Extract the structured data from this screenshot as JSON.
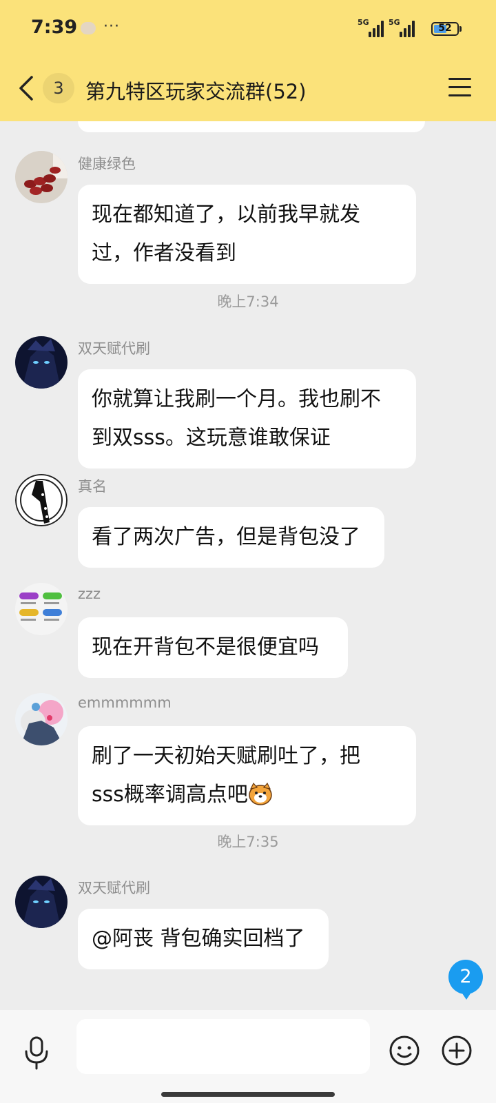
{
  "status_bar": {
    "time": "7:39",
    "dots": "···",
    "signal_1_label": "5G",
    "signal_2_label": "5G",
    "battery": "52"
  },
  "header": {
    "unread_count": "3",
    "title": "第九特区玩家交流群(52)",
    "back_icon": "chevron-left-icon",
    "menu_icon": "hamburger-menu-icon"
  },
  "messages": [
    {
      "sender": "健康绿色",
      "lines": [
        "现在都知道了，以前我早就发",
        "过，作者没看到"
      ]
    },
    {
      "timestamp": "晚上7:34"
    },
    {
      "sender": "双天赋代刷",
      "lines": [
        "你就算让我刷一个月。我也刷不",
        "到双sss。这玩意谁敢保证"
      ]
    },
    {
      "sender": "真名",
      "lines": [
        "看了两次广告，但是背包没了"
      ]
    },
    {
      "sender": "zzz",
      "lines": [
        "现在开背包不是很便宜吗"
      ]
    },
    {
      "sender": "emmmmmm",
      "lines": [
        "刷了一天初始天赋刷吐了，把",
        "sss概率调高点吧"
      ]
    },
    {
      "timestamp": "晚上7:35"
    },
    {
      "sender": "双天赋代刷",
      "lines": [
        "@阿丧 背包确实回档了"
      ]
    }
  ],
  "float_badge": "2",
  "input": {
    "placeholder": ""
  },
  "colors": {
    "header_bg": "#fbe27a",
    "chat_bg": "#ededed",
    "bubble_bg": "#ffffff",
    "badge_blue": "#1a9cf0"
  }
}
